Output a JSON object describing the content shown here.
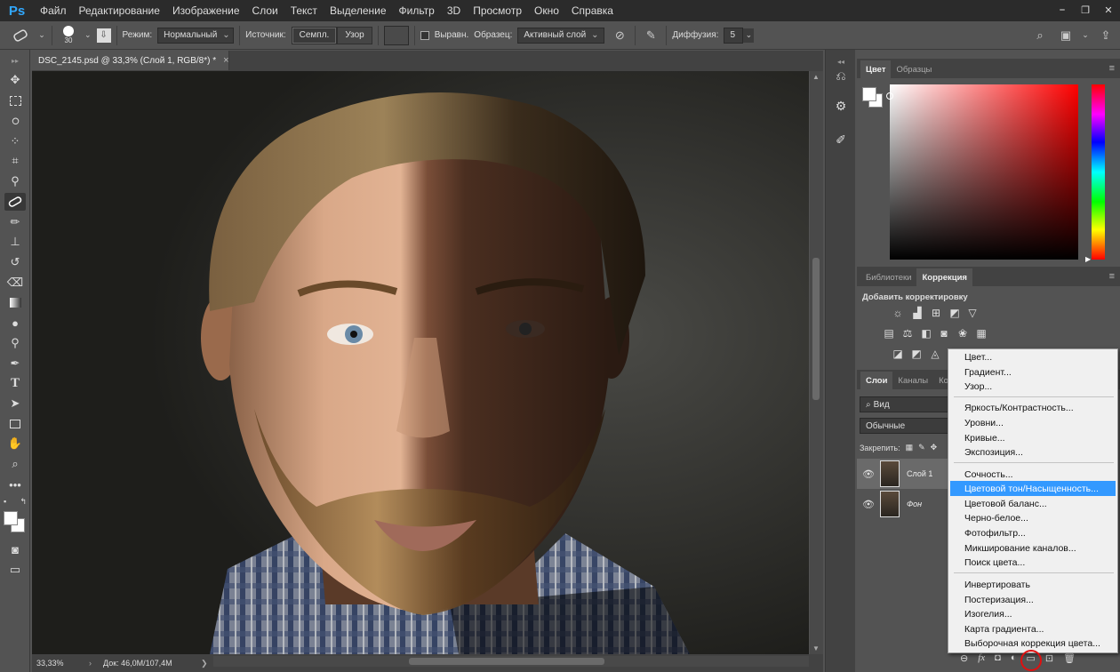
{
  "menubar": {
    "logo": "Ps",
    "items": [
      "Файл",
      "Редактирование",
      "Изображение",
      "Слои",
      "Текст",
      "Выделение",
      "Фильтр",
      "3D",
      "Просмотр",
      "Окно",
      "Справка"
    ],
    "win": [
      "⎯",
      "❐",
      "✕"
    ]
  },
  "options": {
    "brush_size": "30",
    "mode_label": "Режим:",
    "mode_value": "Нормальный",
    "source_label": "Источник:",
    "source_sampled": "Семпл.",
    "source_pattern": "Узор",
    "aligned_label": "Выравн.",
    "sample_label": "Образец:",
    "sample_value": "Активный слой",
    "diffusion_label": "Диффузия:",
    "diffusion_value": "5"
  },
  "document": {
    "tab_title": "DSC_2145.psd @ 33,3% (Слой 1, RGB/8*) *",
    "close": "×",
    "zoom": "33,33%",
    "doc_info": "Док: 46,0M/107,4M"
  },
  "color_panel": {
    "tabs": [
      "Цвет",
      "Образцы"
    ]
  },
  "correction_panel": {
    "tabs": [
      "Библиотеки",
      "Коррекция"
    ],
    "title": "Добавить корректировку"
  },
  "layers_panel": {
    "tabs": [
      "Слои",
      "Каналы",
      "Ко"
    ],
    "search": "Вид",
    "blend": "Обычные",
    "lock_label": "Закрепить:",
    "layers": [
      {
        "name": "Слой 1"
      },
      {
        "name": "Фон"
      }
    ]
  },
  "context_menu": {
    "group1": [
      "Цвет...",
      "Градиент...",
      "Узор..."
    ],
    "group2": [
      "Яркость/Контрастность...",
      "Уровни...",
      "Кривые...",
      "Экспозиция..."
    ],
    "group3": [
      "Сочность...",
      "Цветовой тон/Насыщенность...",
      "Цветовой баланс...",
      "Черно-белое...",
      "Фотофильтр...",
      "Микширование каналов...",
      "Поиск цвета..."
    ],
    "group4": [
      "Инвертировать",
      "Постеризация...",
      "Изогелия...",
      "Карта градиента...",
      "Выборочная коррекция цвета..."
    ],
    "highlighted": "Цветовой тон/Насыщенность..."
  },
  "colors": {
    "accent": "#3399ff",
    "logo": "#31a8ff",
    "highlight_circle": "#e01010"
  }
}
